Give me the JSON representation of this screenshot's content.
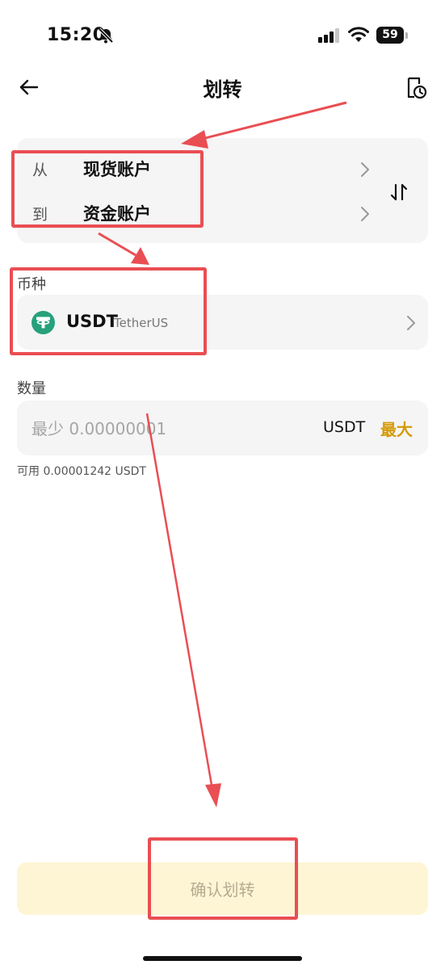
{
  "status_bar": {
    "time": "15:20",
    "battery": "59",
    "icons": [
      "bell-muted-icon",
      "signal-icon",
      "wifi-icon",
      "battery-icon"
    ]
  },
  "nav": {
    "title": "划转",
    "back_icon": "arrow-left-icon",
    "history_icon": "document-clock-icon"
  },
  "transfer": {
    "from_prefix": "从",
    "from_account": "现货账户",
    "to_prefix": "到",
    "to_account": "资金账户",
    "swap_icon": "swap-vertical-icon"
  },
  "coin": {
    "label": "币种",
    "symbol": "USDT",
    "name": "TetherUS",
    "logo_color": "#26a17b"
  },
  "amount": {
    "label": "数量",
    "placeholder": "最少 0.00000001",
    "value": "",
    "unit": "USDT",
    "max_label": "最大",
    "available": "可用 0.00001242 USDT"
  },
  "confirm": {
    "label": "确认划转"
  },
  "colors": {
    "accent": "#f0b90b",
    "max_text": "#d49a0a",
    "confirm_bg": "#fdf5d4",
    "annotation": "#e94e53"
  }
}
